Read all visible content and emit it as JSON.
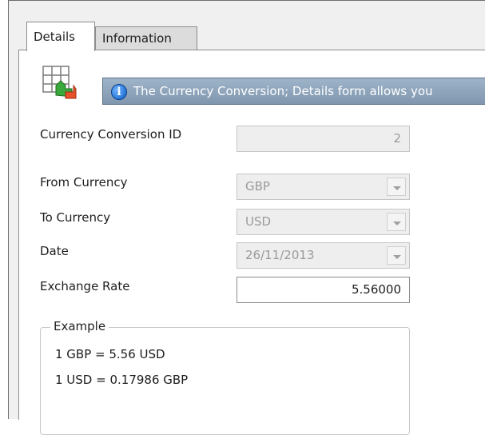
{
  "tabs": [
    {
      "label": "Details",
      "active": true
    },
    {
      "label": "Information",
      "active": false
    }
  ],
  "infobar": {
    "text": "The Currency Conversion; Details form allows you"
  },
  "form": {
    "id_label": "Currency Conversion ID",
    "id_value": "2",
    "from_label": "From Currency",
    "from_value": "GBP",
    "to_label": "To Currency",
    "to_value": "USD",
    "date_label": "Date",
    "date_value": "26/11/2013",
    "rate_label": "Exchange Rate",
    "rate_value": "5.56000"
  },
  "example": {
    "title": "Example",
    "line1": "1 GBP = 5.56 USD",
    "line2": "1 USD = 0.17986 GBP"
  }
}
